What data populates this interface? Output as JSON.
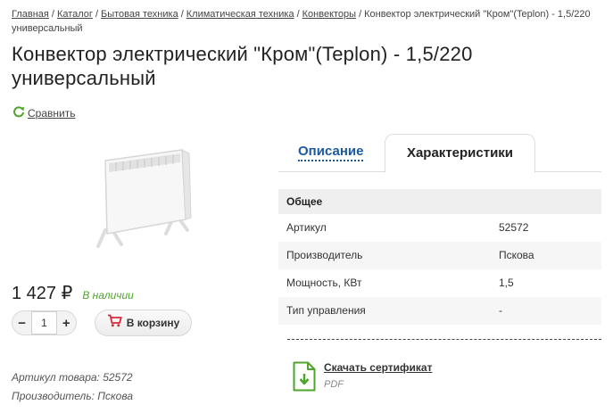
{
  "breadcrumb": {
    "items": [
      "Главная",
      "Каталог",
      "Бытовая техника",
      "Климатическая техника",
      "Конвекторы"
    ],
    "current": "Конвектор электрический \"Кром\"(Teplon) - 1,5/220 универсальный"
  },
  "product": {
    "title": "Конвектор электрический \"Кром\"(Teplon) - 1,5/220 универсальный",
    "compare_label": "Сравнить",
    "price": "1 427 ₽",
    "stock": "В наличии",
    "quantity": "1",
    "cart_label": "В корзину",
    "article_line": "Артикул товара: 52572",
    "maker_line": "Производитель: Пскова"
  },
  "tabs": {
    "description": "Описание",
    "characteristics": "Характеристики"
  },
  "specs": {
    "group": "Общее",
    "rows": [
      {
        "key": "Артикул",
        "value": "52572"
      },
      {
        "key": "Производитель",
        "value": "Пскова"
      },
      {
        "key": "Мощность, КВт",
        "value": "1,5"
      },
      {
        "key": "Тип управления",
        "value": "-"
      }
    ]
  },
  "certificate": {
    "link": "Скачать сертификат",
    "format": "PDF"
  },
  "colors": {
    "accent_link": "#1c5aa0",
    "in_stock": "#4fa52b",
    "cart_icon": "#d8283a",
    "pdf_icon": "#4fa52b"
  }
}
